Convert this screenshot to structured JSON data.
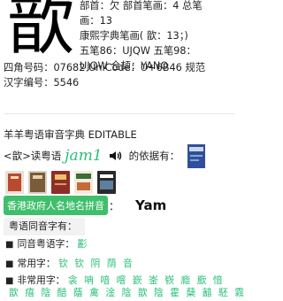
{
  "entry": {
    "character": "歆",
    "radical_line": "部首：欠  部首笔画：4  总笔",
    "total_strokes_line": "画：13",
    "kangxi_line": "康熙字典笔画( 歆：13；)",
    "wubi_line": "五笔86：UJQW   五笔98：",
    "cangjie_line": "UJQW  仓颉：YANO",
    "code_line": "四角号码：07682   UniCode：U+6B46   规范",
    "standard_line": "汉字编号：5546"
  },
  "dictionary": {
    "title": "羊羊粤语审音字典 EDITABLE",
    "reading_prefix": "<歆>读粤语",
    "jyutping": "jam1",
    "reading_suffix": "的依据有：",
    "speaker_icon": "speaker-icon",
    "gov_label": "香港政府人名地名拼音",
    "gov_colon": "：",
    "gov_value": "Yam",
    "homophones_heading": "粤语同音字有：",
    "rare": {
      "label": "同音粤语字：",
      "chars": "彲"
    },
    "common": {
      "label": "常用字：",
      "chars": "钦 钦 阴 荫 音"
    },
    "uncommon": {
      "label": "非常用字：",
      "chars": "衾 呥 喑 噾 嶔 崟 嵚 廕 廞 愔"
    },
    "uncommon_more": "歆 瘖 陰 醅 蔭 禽 淦 陰 歆 陰 霍 蘖 韽 駓 霧"
  },
  "colors": {
    "accent_green": "#29c07a",
    "badge_green": "#3fbf6b"
  }
}
